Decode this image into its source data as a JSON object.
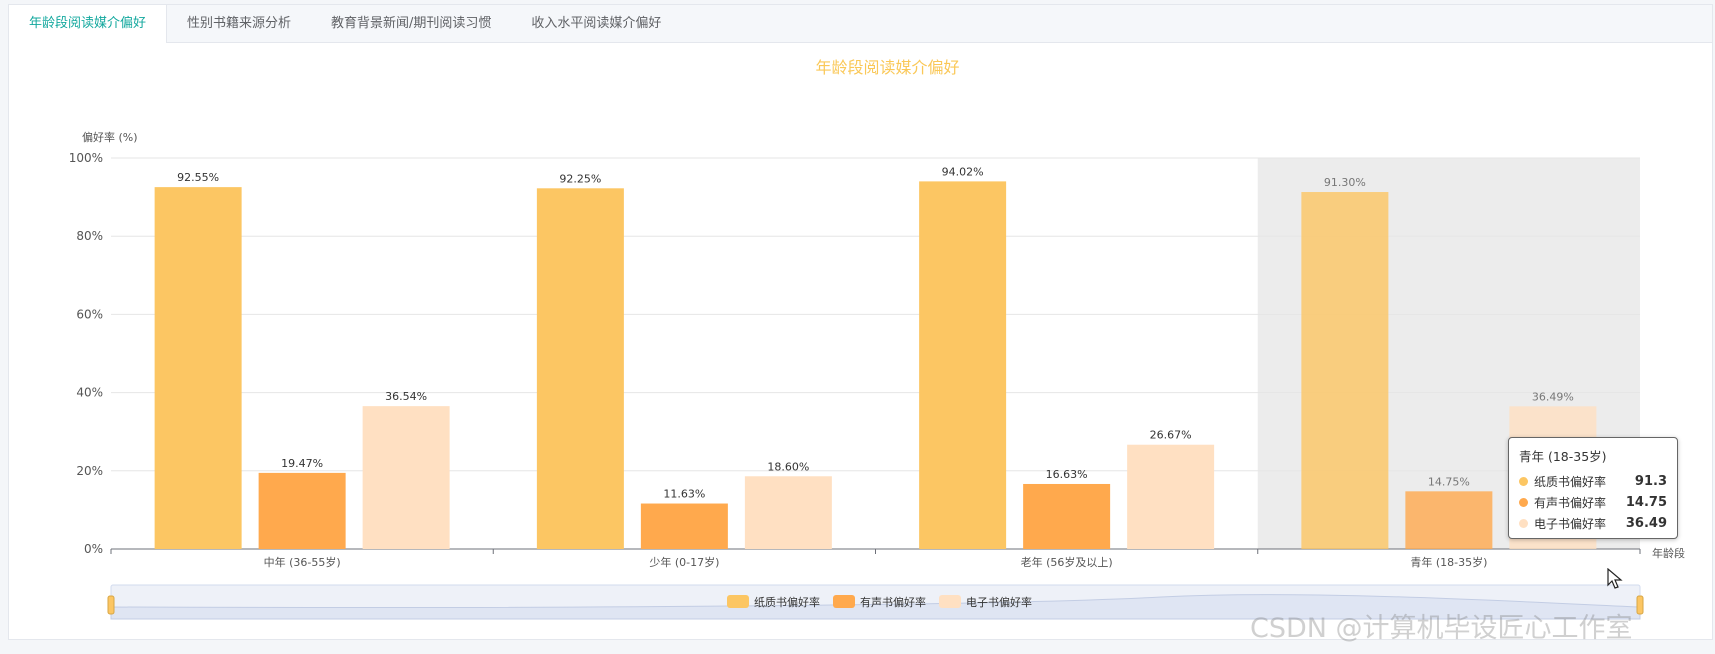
{
  "tabs": [
    {
      "label": "年龄段阅读媒介偏好",
      "active": true
    },
    {
      "label": "性别书籍来源分析",
      "active": false
    },
    {
      "label": "教育背景新闻/期刊阅读习惯",
      "active": false
    },
    {
      "label": "收入水平阅读媒介偏好",
      "active": false
    }
  ],
  "colors": {
    "title": "#fac858",
    "paper": "#fcc663",
    "audio": "#ffa94d",
    "ebook": "#ffe0c2",
    "highlight_bg": "#ececec"
  },
  "chart_data": {
    "type": "bar",
    "title": "年龄段阅读媒介偏好",
    "ylabel": "偏好率 (%)",
    "xlabel": "年龄段",
    "ylim": [
      0,
      100
    ],
    "yticks": [
      "0%",
      "20%",
      "40%",
      "60%",
      "80%",
      "100%"
    ],
    "categories": [
      "中年 (36-55岁)",
      "少年 (0-17岁)",
      "老年 (56岁及以上)",
      "青年 (18-35岁)"
    ],
    "series": [
      {
        "name": "纸质书偏好率",
        "values": [
          92.55,
          92.25,
          94.02,
          91.3
        ],
        "labels": [
          "92.55%",
          "92.25%",
          "94.02%",
          "91.30%"
        ]
      },
      {
        "name": "有声书偏好率",
        "values": [
          19.47,
          11.63,
          16.63,
          14.75
        ],
        "labels": [
          "19.47%",
          "11.63%",
          "16.63%",
          "14.75%"
        ]
      },
      {
        "name": "电子书偏好率",
        "values": [
          36.54,
          18.6,
          26.67,
          36.49
        ],
        "labels": [
          "36.54%",
          "18.60%",
          "26.67%",
          "36.49%"
        ]
      }
    ],
    "highlighted_category": "青年 (18-35岁)",
    "legend_position": "bottom",
    "grid": true
  },
  "tooltip": {
    "title": "青年 (18-35岁)",
    "rows": [
      {
        "name": "纸质书偏好率",
        "value": "91.3"
      },
      {
        "name": "有声书偏好率",
        "value": "14.75"
      },
      {
        "name": "电子书偏好率",
        "value": "36.49"
      }
    ]
  },
  "watermark": "CSDN @计算机毕设匠心工作室"
}
